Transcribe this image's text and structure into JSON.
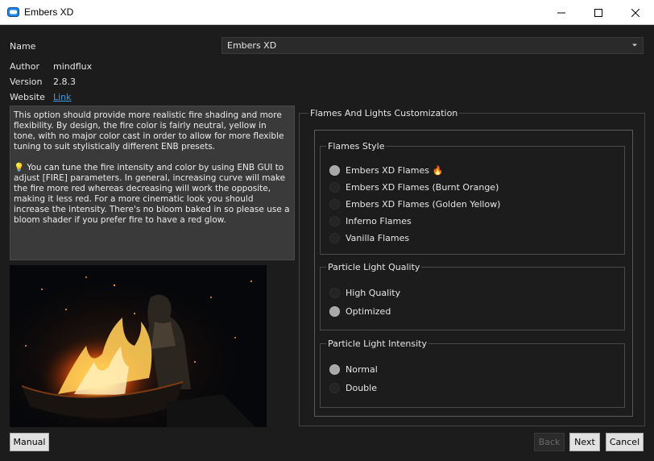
{
  "window": {
    "title": "Embers XD",
    "min_label": "—",
    "max_label": "☐",
    "close_label": "✕"
  },
  "fields": {
    "name_label": "Name",
    "name_value": "Embers XD",
    "author_label": "Author",
    "author_value": "mindflux",
    "version_label": "Version",
    "version_value": "2.8.3",
    "website_label": "Website",
    "website_value": "Link"
  },
  "description": {
    "para1": "This option should provide more realistic fire shading and more flexibility. By design, the fire color is fairly neutral, yellow in tone, with no major color cast in order to allow for more flexible tuning to suit stylistically different ENB presets.",
    "bulb": "💡",
    "para2": "You can tune the fire intensity and color by using ENB GUI to adjust [FIRE] parameters. In general, increasing curve will make the fire more red whereas decreasing will work the opposite, making it less red. For a more cinematic look you should increase the intensity. There's no bloom baked in so please use a bloom shader if you prefer fire to have a red glow."
  },
  "customization": {
    "title": "Flames And Lights Customization",
    "groups": [
      {
        "title": "Flames Style",
        "options": [
          {
            "label": "Embers XD Flames 🔥",
            "checked": true
          },
          {
            "label": "Embers XD Flames (Burnt Orange)",
            "checked": false
          },
          {
            "label": "Embers XD Flames (Golden Yellow)",
            "checked": false
          },
          {
            "label": "Inferno Flames",
            "checked": false
          },
          {
            "label": "Vanilla Flames",
            "checked": false
          }
        ]
      },
      {
        "title": "Particle Light Quality",
        "options": [
          {
            "label": "High Quality",
            "checked": false
          },
          {
            "label": "Optimized",
            "checked": true
          }
        ]
      },
      {
        "title": "Particle Light Intensity",
        "options": [
          {
            "label": "Normal",
            "checked": true
          },
          {
            "label": "Double",
            "checked": false
          }
        ]
      }
    ]
  },
  "buttons": {
    "manual": "Manual",
    "back": "Back",
    "next": "Next",
    "cancel": "Cancel"
  },
  "colors": {
    "background": "#1c1c1c",
    "link": "#3b9de0",
    "description_bg": "#3a3a3a"
  }
}
